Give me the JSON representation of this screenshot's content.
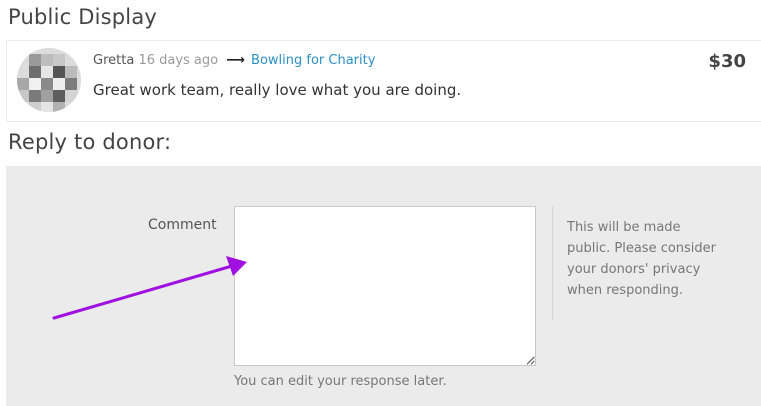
{
  "public_display": {
    "title": "Public Display",
    "donation": {
      "donor": "Gretta",
      "time_ago": "16 days ago",
      "arrow": "⟶",
      "campaign": "Bowling for Charity",
      "amount": "$30",
      "message": "Great work team, really love what you are doing."
    }
  },
  "reply": {
    "title": "Reply to donor:",
    "comment_label": "Comment",
    "comment_value": "",
    "help_text": "This will be made public. Please consider your donors' privacy when responding.",
    "hint": "You can edit your response later."
  },
  "colors": {
    "link": "#2a8fc1",
    "annotation_arrow": "#a010e0",
    "panel_bg": "#ebebeb"
  }
}
